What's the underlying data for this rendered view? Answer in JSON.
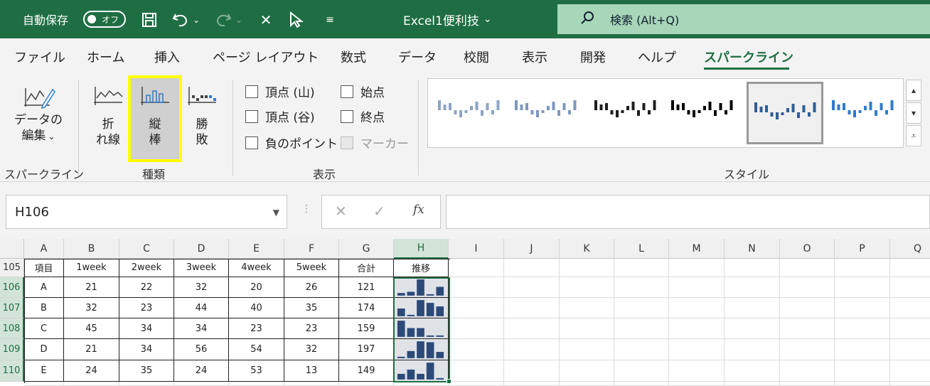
{
  "titlebar": {
    "autosave_label": "自動保存",
    "toggle_text": "オフ",
    "doc_title": "Excel1便利技",
    "search_placeholder": "検索 (Alt+Q)"
  },
  "tabs": [
    "ファイル",
    "ホーム",
    "挿入",
    "ページ レイアウト",
    "数式",
    "データ",
    "校閲",
    "表示",
    "開発",
    "ヘルプ",
    "スパークライン"
  ],
  "active_tab": "スパークライン",
  "ribbon": {
    "sparkline_group": {
      "edit_data_label_1": "データの",
      "edit_data_label_2": "編集",
      "label": "スパークライン"
    },
    "type_group": {
      "line_label_1": "折",
      "line_label_2": "れ線",
      "column_label_1": "縦",
      "column_label_2": "棒",
      "winloss_label_1": "勝",
      "winloss_label_2": "敗",
      "label": "種類"
    },
    "show_group": {
      "high_point": "頂点 (山)",
      "low_point": "頂点 (谷)",
      "negative_points": "負のポイント",
      "first_point": "始点",
      "last_point": "終点",
      "markers": "マーカー",
      "label": "表示"
    },
    "style_group": {
      "label": "スタイル",
      "styles": [
        {
          "color": "#8ea4c4"
        },
        {
          "color": "#7f97bd"
        },
        {
          "color": "#1e1e1e"
        },
        {
          "color": "#000000"
        },
        {
          "color": "#2f5e97"
        },
        {
          "color": "#2e7bcf"
        }
      ],
      "selected_index": 4
    }
  },
  "formula_bar": {
    "name_box": "H106",
    "fx": "fx"
  },
  "grid": {
    "columns": [
      "A",
      "B",
      "C",
      "D",
      "E",
      "F",
      "G",
      "H",
      "I",
      "J",
      "K",
      "L",
      "M",
      "N",
      "O",
      "P",
      "Q"
    ],
    "selected_column": "H",
    "header_row_number": "105",
    "headers": [
      "項目",
      "1week",
      "2week",
      "3week",
      "4week",
      "5week",
      "合計",
      "推移"
    ],
    "rows": [
      {
        "num": "106",
        "item": "A",
        "values": [
          "21",
          "22",
          "32",
          "20",
          "26"
        ],
        "total": "121"
      },
      {
        "num": "107",
        "item": "B",
        "values": [
          "32",
          "23",
          "44",
          "40",
          "35"
        ],
        "total": "174"
      },
      {
        "num": "108",
        "item": "C",
        "values": [
          "45",
          "34",
          "34",
          "23",
          "23"
        ],
        "total": "159"
      },
      {
        "num": "109",
        "item": "D",
        "values": [
          "21",
          "34",
          "56",
          "54",
          "32"
        ],
        "total": "197"
      },
      {
        "num": "110",
        "item": "E",
        "values": [
          "24",
          "35",
          "24",
          "53",
          "13"
        ],
        "total": "149"
      }
    ],
    "sparkline_color": "#2c4a78"
  }
}
